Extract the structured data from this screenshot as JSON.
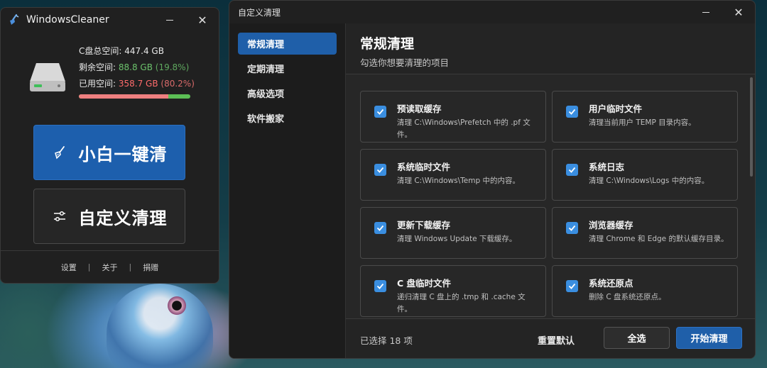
{
  "left_window": {
    "title": "WindowsCleaner",
    "disk": {
      "total_label": "C盘总空间: 447.4 GB",
      "free_prefix": "剩余空间: ",
      "free_value": "88.8 GB",
      "free_pct": "(19.8%)",
      "used_prefix": "已用空间: ",
      "used_value": "358.7 GB",
      "used_pct": "(80.2%)",
      "used_fraction": 0.802
    },
    "one_click_label": "小白一键清",
    "custom_label": "自定义清理",
    "footer": {
      "settings": "设置",
      "sep": "|",
      "about": "关于",
      "donate": "捐赠"
    }
  },
  "right_window": {
    "title": "自定义清理",
    "nav": [
      "常规清理",
      "定期清理",
      "高级选项",
      "软件搬家"
    ],
    "content_title": "常规清理",
    "content_subtitle": "勾选你想要清理的项目",
    "items": [
      {
        "title": "预读取缓存",
        "desc": "清理 C:\\Windows\\Prefetch 中的 .pf 文件。",
        "checked": true
      },
      {
        "title": "用户临时文件",
        "desc": "清理当前用户 TEMP 目录内容。",
        "checked": true
      },
      {
        "title": "系统临时文件",
        "desc": "清理 C:\\Windows\\Temp 中的内容。",
        "checked": true
      },
      {
        "title": "系统日志",
        "desc": "清理 C:\\Windows\\Logs 中的内容。",
        "checked": true
      },
      {
        "title": "更新下载缓存",
        "desc": "清理 Windows Update 下载缓存。",
        "checked": true
      },
      {
        "title": "浏览器缓存",
        "desc": "清理 Chrome 和 Edge 的默认缓存目录。",
        "checked": true
      },
      {
        "title": "C 盘临时文件",
        "desc": "递归清理 C 盘上的 .tmp 和 .cache 文件。",
        "checked": true
      },
      {
        "title": "系统还原点",
        "desc": "删除 C 盘系统还原点。",
        "checked": true
      }
    ],
    "selected_count": "已选择 18 项",
    "reset_label": "重置默认",
    "select_all_label": "全选",
    "start_label": "开始清理"
  },
  "colors": {
    "accent": "#1f5fa9",
    "checkbox": "#3a8ee0",
    "free_green": "#6cc26c",
    "used_red": "#ff6b6b"
  }
}
